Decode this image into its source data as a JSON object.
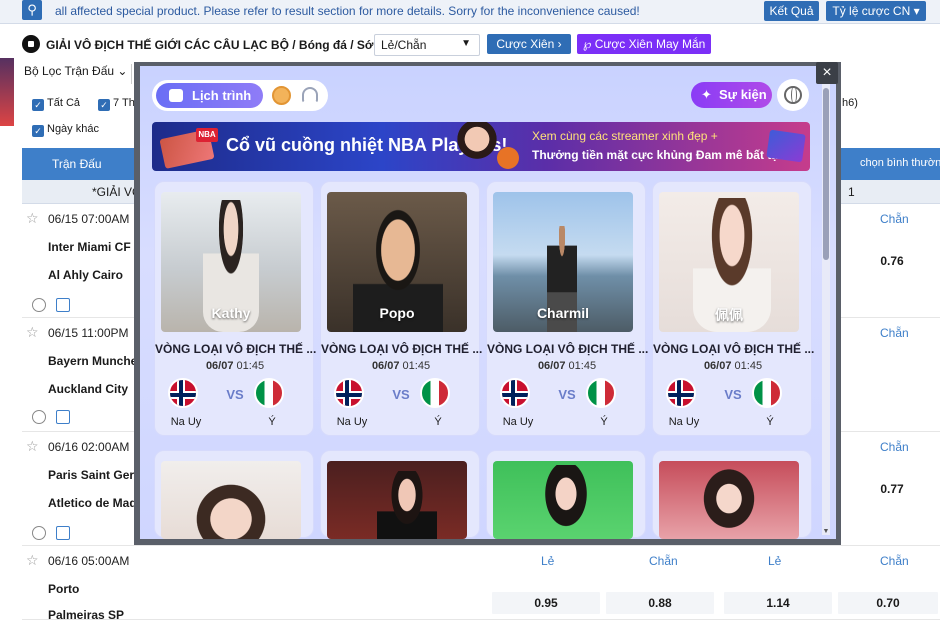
{
  "topbar": {
    "notice": "all affected special product. Please refer to result section for more details. Sorry for the inconvenience caused!",
    "results_button": "Kết Quả",
    "odds_button": "Tỷ lệ cược CN ▾"
  },
  "league": {
    "title": "GIẢI VÔ ĐỊCH THẾ GIỚI CÁC CÂU LẠC BỘ / Bóng đá / Sớm",
    "select_value": "Lẻ/Chẵn",
    "parlay_button": "Cược Xiên",
    "lucky_parlay_button": "Cược Xiên May Mắn"
  },
  "filters": {
    "filter_label": "Bộ Lọc Trận Đấu",
    "all": "Tất Cả",
    "seven": "7 Th",
    "other_days": "Ngày khác",
    "right_partial": "h6)"
  },
  "table": {
    "col_match": "Trận Đấu",
    "col_right": "chọn bình thường",
    "league_row": "*GIẢI VÔ",
    "right_num": "1",
    "matches": [
      {
        "time": "06/15 07:00AM",
        "home": "Inter Miami CF",
        "away": "Al Ahly Cairo",
        "label": "Chẵn",
        "odd": "0.76"
      },
      {
        "time": "06/15 11:00PM",
        "home": "Bayern Munche",
        "away": "Auckland City",
        "label": "Chẵn",
        "odd": ""
      },
      {
        "time": "06/16 02:00AM",
        "home": "Paris Saint Gern",
        "away": "Atletico de Mad",
        "label": "Chẵn",
        "odd": "0.77"
      },
      {
        "time": "06/16 05:00AM",
        "home": "Porto",
        "away": "Palmeiras SP",
        "labels": [
          "Lẻ",
          "Chẵn",
          "Lẻ",
          "Chẵn"
        ],
        "odds": [
          "0.95",
          "0.88",
          "1.14",
          "0.70"
        ]
      }
    ]
  },
  "modal": {
    "tab_schedule": "Lịch trình",
    "event_button": "Sự kiện",
    "close": "×",
    "banner": {
      "badge": "NBA",
      "title": "Cổ vũ cuồng nhiệt NBA Playoffs!",
      "line1": "Xem cùng các streamer xinh đẹp +",
      "line2": "Thưởng tiền mặt cực khủng  Đam mê bất tận!"
    },
    "cards": [
      {
        "name": "Kathy",
        "league": "VÒNG LOẠI VÔ ĐỊCH THẾ ...",
        "date": "06/07",
        "time": "01:45",
        "team_a": "Na Uy",
        "team_b": "Ý",
        "vs": "VS"
      },
      {
        "name": "Popo",
        "league": "VÒNG LOẠI VÔ ĐỊCH THẾ ...",
        "date": "06/07",
        "time": "01:45",
        "team_a": "Na Uy",
        "team_b": "Ý",
        "vs": "VS"
      },
      {
        "name": "Charmil",
        "league": "VÒNG LOẠI VÔ ĐỊCH THẾ ...",
        "date": "06/07",
        "time": "01:45",
        "team_a": "Na Uy",
        "team_b": "Ý",
        "vs": "VS"
      },
      {
        "name": "佩佩",
        "league": "VÒNG LOẠI VÔ ĐỊCH THẾ ...",
        "date": "06/07",
        "time": "01:45",
        "team_a": "Na Uy",
        "team_b": "Ý",
        "vs": "VS"
      }
    ]
  },
  "colors": {
    "primary_blue": "#2f6db5",
    "header_blue": "#3e7fc9",
    "purple": "#7b2ff7",
    "modal_bg": "#cfd6ff"
  },
  "icons": [
    "search-icon",
    "soccer-ball-icon",
    "chevron-down-icon",
    "star-icon",
    "calendar-icon",
    "cookie-icon",
    "headset-icon",
    "sparkle-icon",
    "globe-icon",
    "close-icon"
  ]
}
